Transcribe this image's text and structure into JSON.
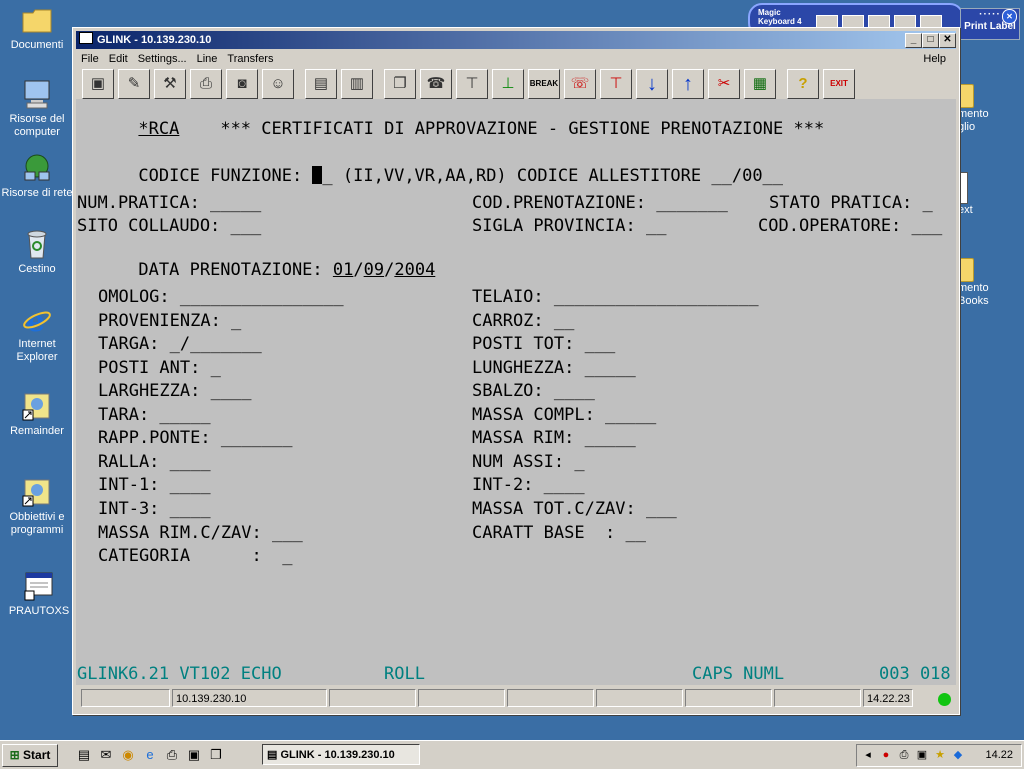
{
  "desktop": {
    "icons": [
      {
        "label": "Documenti"
      },
      {
        "label": "Risorse del computer"
      },
      {
        "label": "Risorse di rete"
      },
      {
        "label": "Cestino"
      },
      {
        "label": "Internet Explorer"
      },
      {
        "label": "Remainder"
      },
      {
        "label": "Obbiettivi e programmi"
      },
      {
        "label": "PRAUTOXS"
      }
    ],
    "right_icons": [
      {
        "label": "mento\nglio"
      },
      {
        "label": "ext"
      },
      {
        "label": "mento\nBooks"
      }
    ],
    "magic_keyboard": {
      "title": "Magic\nKeyboard 4"
    },
    "print_label": {
      "label": "Print Label"
    }
  },
  "window": {
    "title": "GLINK - 10.139.230.10",
    "menu": [
      "File",
      "Edit",
      "Settings...",
      "Line",
      "Transfers"
    ],
    "help": "Help",
    "toolbar": {
      "break_label": "BREAK",
      "exit_label": "EXIT"
    }
  },
  "terminal": {
    "header_code": "*RCA",
    "header_title": "*** CERTIFICATI DI APPROVAZIONE - GESTIONE PRENOTAZIONE ***",
    "codice_funzione": {
      "label": "CODICE FUNZIONE: ",
      "cursor_tail": "_",
      "options": " (II,VV,VR,AA,RD) CODICE ALLESTITORE ",
      "allestitore": "__/00__"
    },
    "num_pratica": "NUM.PRATICA: _____",
    "sito_collaudo": "SITO COLLAUDO: ___",
    "data_prenotazione": {
      "label": "DATA PRENOTAZIONE: ",
      "day": "01",
      "sep1": "/",
      "month": "09",
      "sep2": "/",
      "year": "2004"
    },
    "cod_prenotazione": "COD.PRENOTAZIONE: _______",
    "stato_pratica": "STATO PRATICA: _",
    "sigla_provincia": "SIGLA PROVINCIA: __",
    "cod_operatore": "COD.OPERATORE: ___",
    "left_fields": [
      "OMOLOG: ________________",
      "PROVENIENZA: _",
      "TARGA: _/_______",
      "POSTI ANT: _",
      "LARGHEZZA: ____",
      "TARA: _____",
      "RAPP.PONTE: _______",
      "RALLA: ____",
      "INT-1: ____",
      "INT-3: ____",
      "MASSA RIM.C/ZAV: ___",
      "CATEGORIA      :  _"
    ],
    "right_fields": [
      "TELAIO: ____________________",
      "CARROZ: __",
      "POSTI TOT: ___",
      "LUNGHEZZA: _____",
      "SBALZO: ____",
      "MASSA COMPL: _____",
      "MASSA RIM: _____",
      "NUM ASSI: _",
      "INT-2: ____",
      "MASSA TOT.C/ZAV: ___",
      "CARATT BASE  : __"
    ],
    "bottom_left": "GLINK6.21 VT102 ECHO",
    "bottom_roll": "ROLL",
    "bottom_caps": "CAPS NUML",
    "bottom_pos": "003 018"
  },
  "statusbar": {
    "host": "10.139.230.10",
    "time": "14.22.23"
  },
  "taskbar": {
    "start": "Start",
    "task": "GLINK - 10.139.230.10",
    "clock": "14.22"
  }
}
